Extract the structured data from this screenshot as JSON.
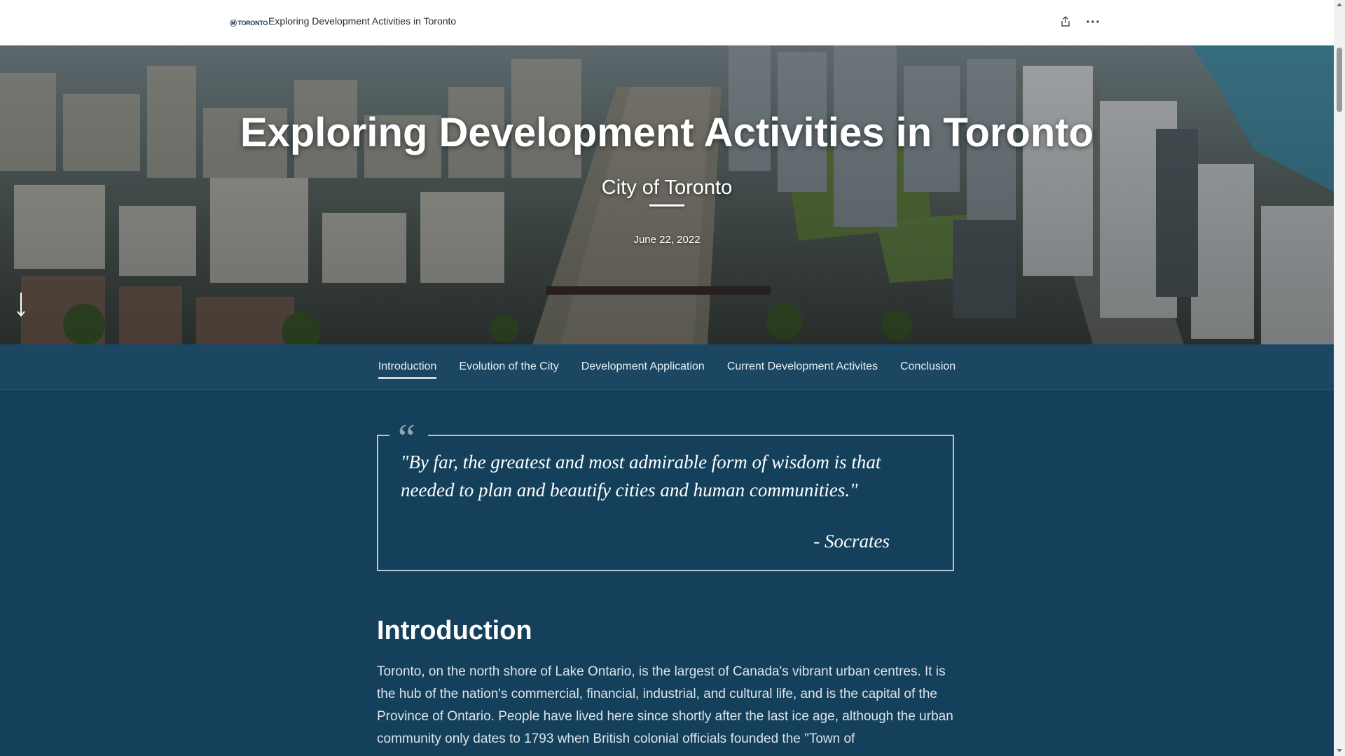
{
  "header": {
    "logo_mark": "Ⓜ",
    "logo_text": "TORONTO",
    "title": "Exploring Development Activities in Toronto",
    "share_icon": "share-icon",
    "more_icon": "more-options-icon"
  },
  "hero": {
    "title": "Exploring Development Activities in Toronto",
    "subtitle": "City of Toronto",
    "date": "June 22, 2022",
    "scroll_icon": "arrow-down-icon"
  },
  "nav": {
    "items": [
      {
        "label": "Introduction",
        "active": true
      },
      {
        "label": "Evolution of the City",
        "active": false
      },
      {
        "label": "Development Application",
        "active": false
      },
      {
        "label": "Current Development Activites",
        "active": false
      },
      {
        "label": "Conclusion",
        "active": false
      }
    ]
  },
  "quote": {
    "mark": "“",
    "text": "\"By far, the greatest and most admirable form of wisdom is that needed to plan and beautify cities and human communities.\"",
    "author": "- Socrates"
  },
  "intro": {
    "heading": "Introduction",
    "body": "Toronto, on the north shore of Lake Ontario, is the largest of Canada's vibrant urban centres. It is the hub of the nation's commercial, financial, industrial, and cultural life, and is the capital of the Province of Ontario. People have lived here since shortly after the last ice age, although the urban community only dates to 1793 when British colonial officials founded the \"Town of"
  },
  "colors": {
    "page_bg": "#15405c",
    "nav_bg": "#1b4763",
    "header_bg": "#ffffff"
  }
}
